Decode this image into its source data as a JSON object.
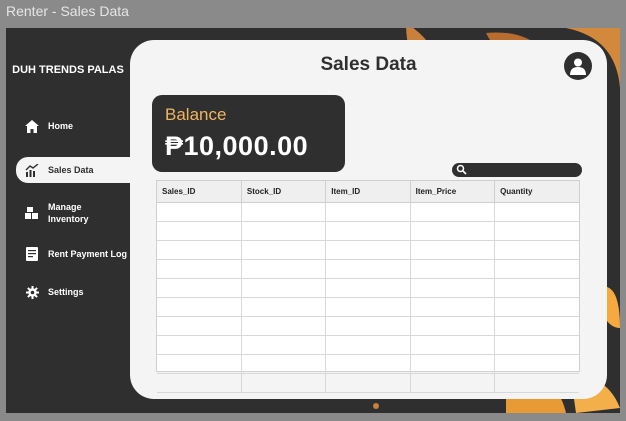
{
  "window": {
    "title": "Renter - Sales Data"
  },
  "sidebar": {
    "brand": "DUH TRENDS PALAS",
    "items": [
      {
        "label": "Home",
        "icon": "home-icon"
      },
      {
        "label": "Sales Data",
        "icon": "chart-icon",
        "active": true
      },
      {
        "label": "Manage Inventory",
        "icon": "boxes-icon"
      },
      {
        "label": "Rent Payment Log",
        "icon": "receipt-icon"
      },
      {
        "label": "Settings",
        "icon": "gear-icon"
      }
    ]
  },
  "main": {
    "title": "Sales Data",
    "balance": {
      "label": "Balance",
      "value": "₱10,000.00"
    },
    "search": {
      "placeholder": ""
    },
    "table": {
      "columns": [
        "Sales_ID",
        "Stock_ID",
        "Item_ID",
        "Item_Price",
        "Quantity"
      ],
      "rows": [
        [
          "",
          "",
          "",
          "",
          ""
        ],
        [
          "",
          "",
          "",
          "",
          ""
        ],
        [
          "",
          "",
          "",
          "",
          ""
        ],
        [
          "",
          "",
          "",
          "",
          ""
        ],
        [
          "",
          "",
          "",
          "",
          ""
        ],
        [
          "",
          "",
          "",
          "",
          ""
        ],
        [
          "",
          "",
          "",
          "",
          ""
        ],
        [
          "",
          "",
          "",
          "",
          ""
        ],
        [
          "",
          "",
          "",
          "",
          ""
        ],
        [
          "",
          "",
          "",
          "",
          ""
        ]
      ]
    }
  },
  "colors": {
    "sidebar_bg": "#2f2f2f",
    "card_bg": "#f4f4f4",
    "accent": "#f0b460"
  }
}
